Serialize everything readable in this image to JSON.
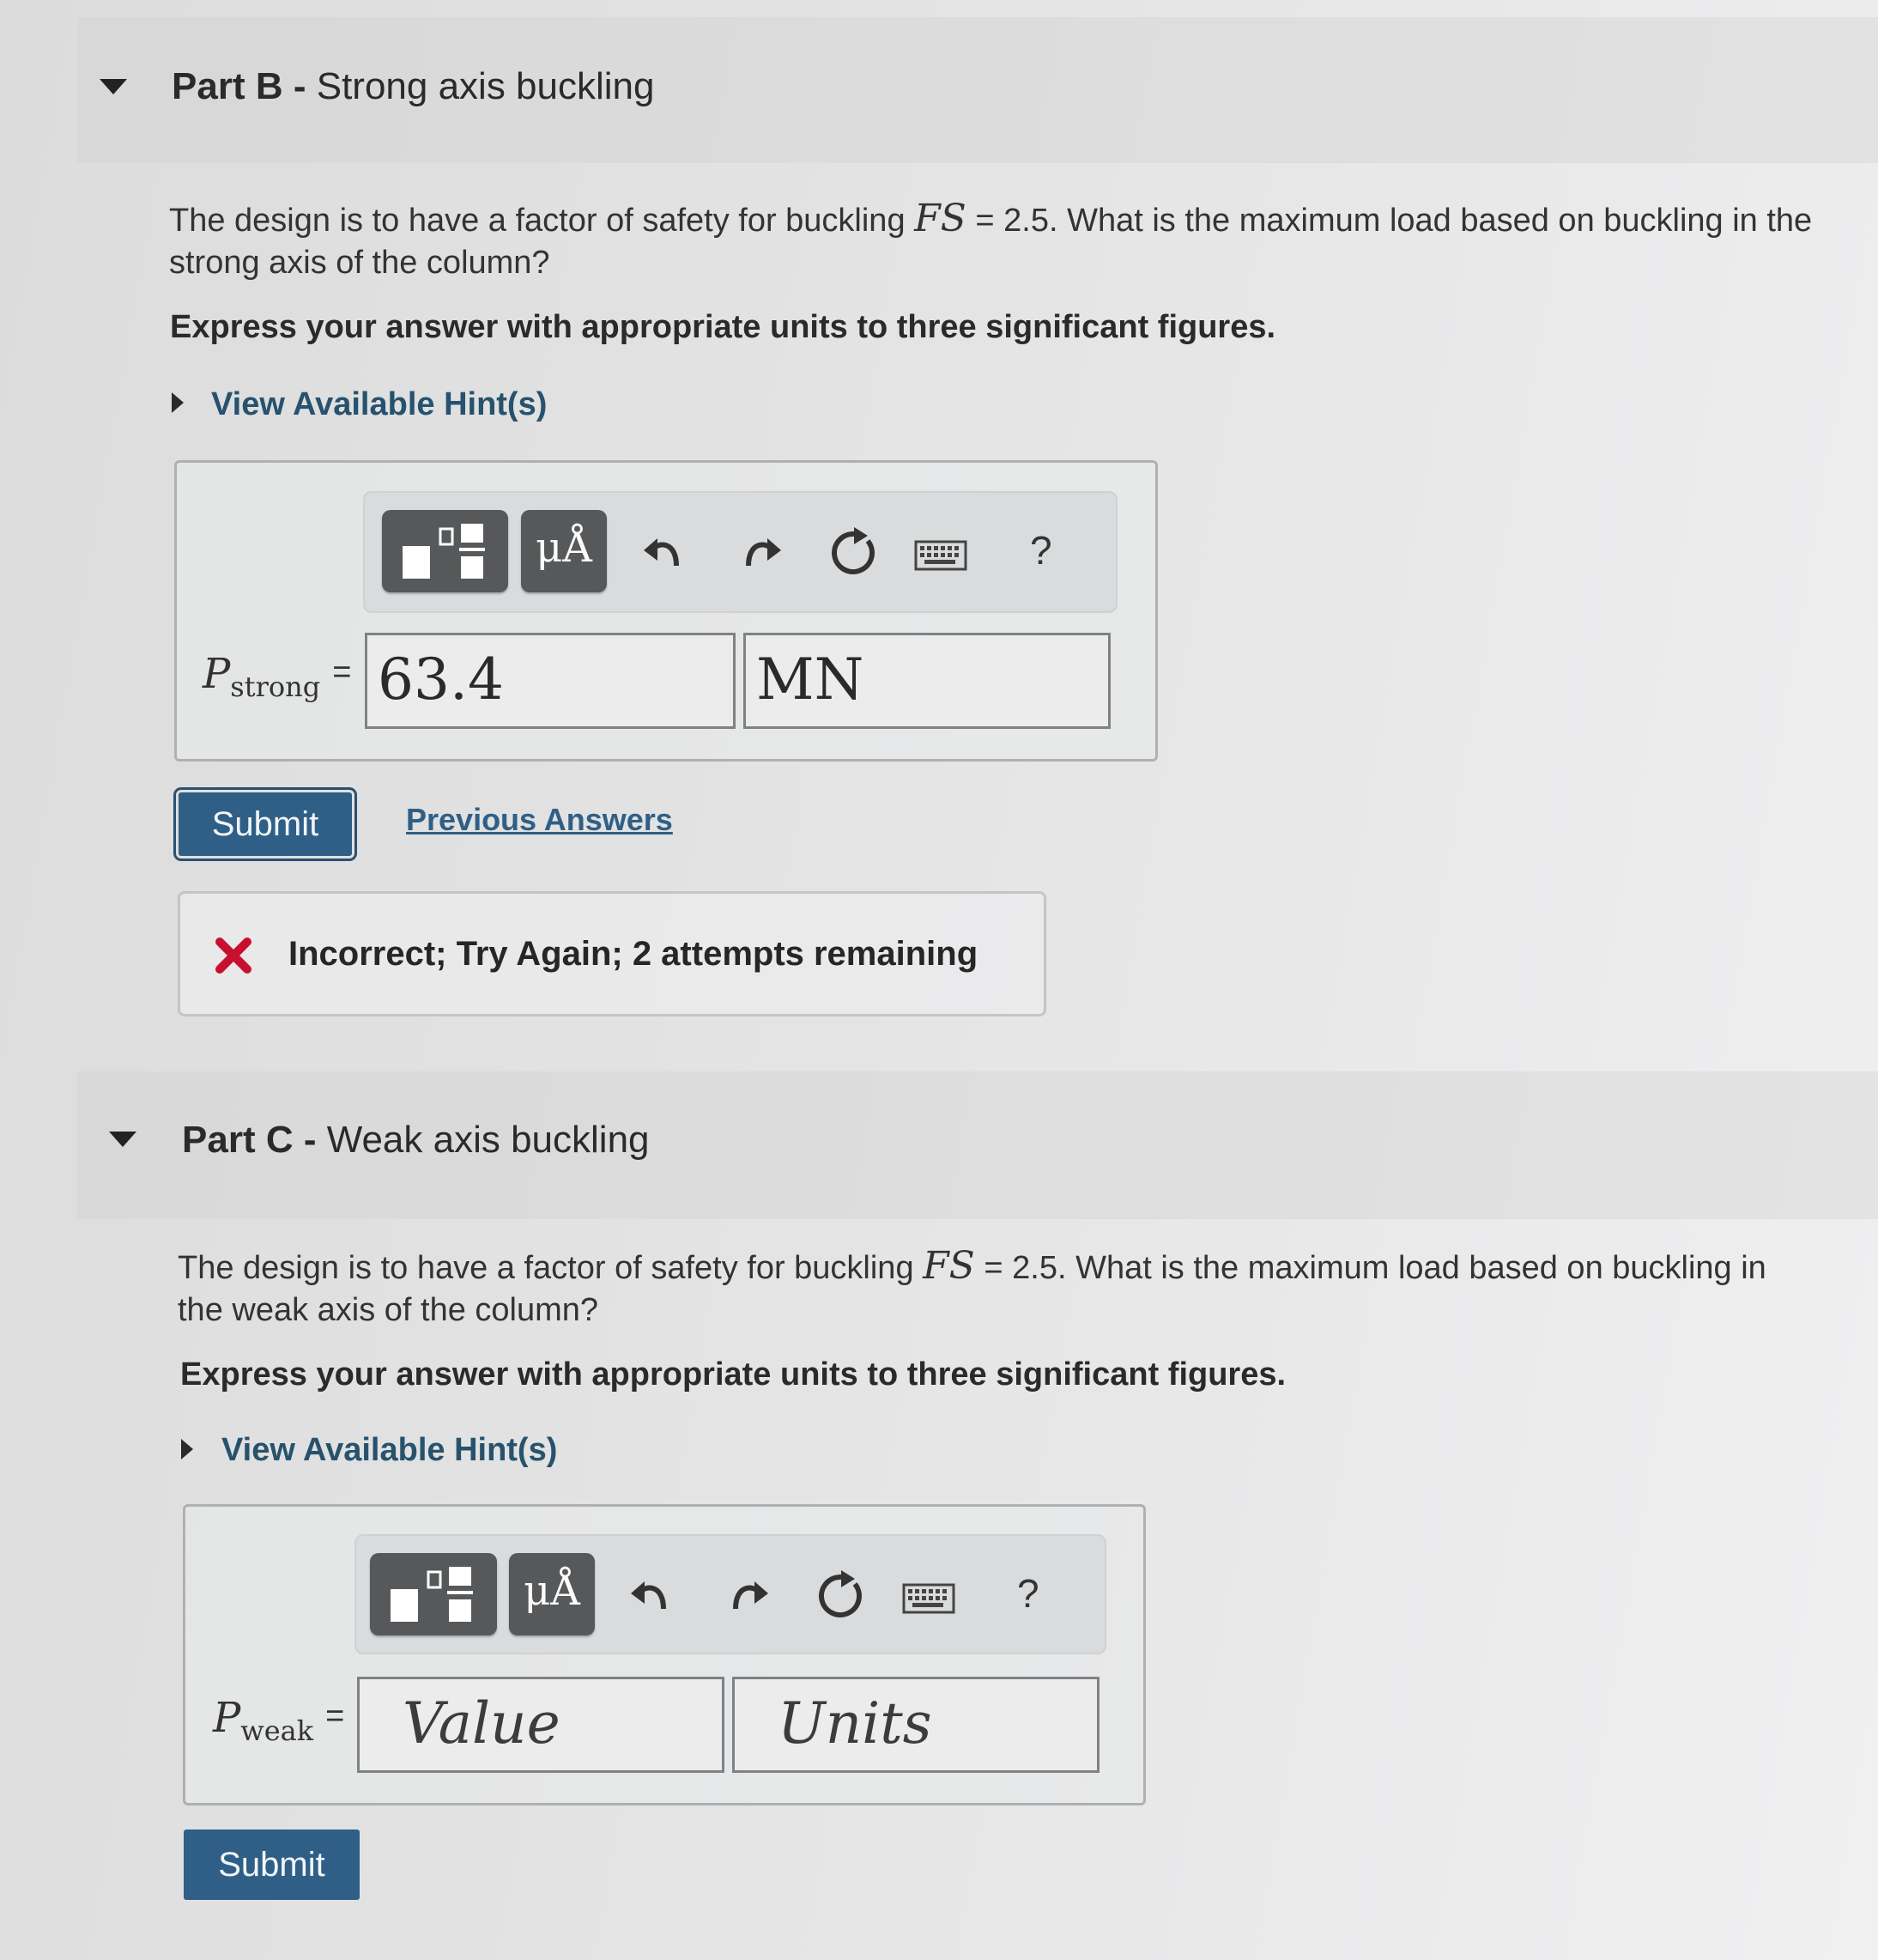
{
  "part_b": {
    "label": "Part B -",
    "title": "Strong axis buckling",
    "question_pre": "The design is to have a factor of safety for buckling",
    "question_math": "FS",
    "question_eq": " = 2.5. What is the maximum load based on buckling in the strong axis of the column?",
    "instruction": "Express your answer with appropriate units to three significant figures.",
    "hint_link": "View Available Hint(s)",
    "toolbar": {
      "units_button": "μÅ",
      "help": "?"
    },
    "variable": "P",
    "variable_sub": "strong",
    "equals": "=",
    "value": "63.4",
    "units": "MN",
    "submit_label": "Submit",
    "previous_answers_label": "Previous Answers",
    "feedback": "Incorrect; Try Again; 2 attempts remaining",
    "feedback_color": "#c8102e"
  },
  "part_c": {
    "label": "Part C -",
    "title": "Weak axis buckling",
    "question_pre": "The design is to have a factor of safety for buckling",
    "question_math": "FS",
    "question_eq": " = 2.5. What is the maximum load based on buckling in the weak axis of the column?",
    "instruction": "Express your answer with appropriate units to three significant figures.",
    "hint_link": "View Available Hint(s)",
    "toolbar": {
      "units_button": "μÅ",
      "help": "?"
    },
    "variable": "P",
    "variable_sub": "weak",
    "equals": "=",
    "value_placeholder": "Value",
    "units_placeholder": "Units",
    "submit_label": "Submit"
  },
  "icons": [
    "caret-down-icon",
    "caret-right-icon",
    "templates-icon",
    "undo-icon",
    "redo-icon",
    "reset-icon",
    "keyboard-icon",
    "incorrect-x-icon"
  ],
  "colors": {
    "link": "#27526e",
    "submit_bg": "#2f5f86",
    "error": "#c8102e"
  }
}
